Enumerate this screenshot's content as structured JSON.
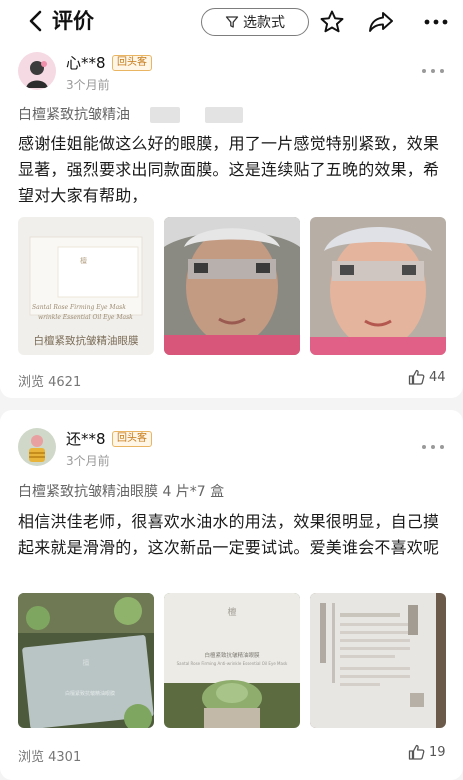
{
  "header": {
    "back_icon": "chevron-left-icon",
    "title": "评价",
    "filter_label": "选款式",
    "filter_icon": "funnel-icon",
    "star_icon": "star-outline-icon",
    "share_icon": "share-arrow-icon",
    "more_icon": "more-dots-icon"
  },
  "reviews": [
    {
      "username": "心**8",
      "badge": "回头客",
      "time": "3个月前",
      "product": "白檀紧致抗皱精油",
      "text": "感谢佳姐能做这么好的眼膜，用了一片感觉特别紧致，效果显著，强烈要求出同款面膜。这是连续贴了五晚的效果，希望对大家有帮助，",
      "photo_caption": "白檀紧致抗皱精油眼膜",
      "views": "浏览 4621",
      "likes": "44"
    },
    {
      "username": "还**8",
      "badge": "回头客",
      "time": "3个月前",
      "product": "白檀紧致抗皱精油眼膜 4 片*7 盒",
      "text": "相信洪佳老师，很喜欢水油水的用法，效果很明显，自己摸起来就是滑滑的，这次新品一定要试试。爱美谁会不喜欢呢",
      "views": "浏览 4301",
      "likes": "19"
    }
  ],
  "colors": {
    "badge_border": "#e9b562",
    "badge_text": "#c57a19",
    "background": "#f4f4f4"
  }
}
